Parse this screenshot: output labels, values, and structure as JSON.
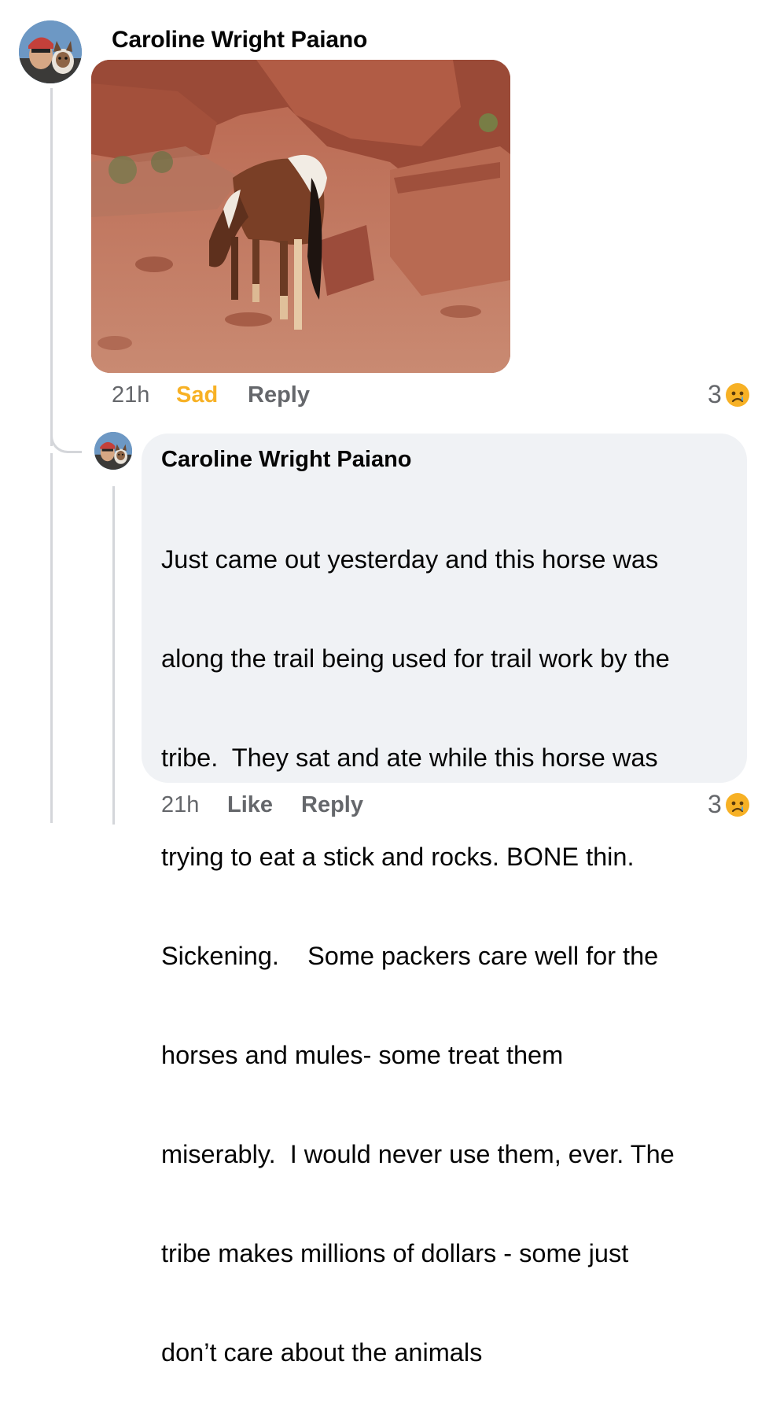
{
  "comment": {
    "author": "Caroline Wright Paiano",
    "time": "21h",
    "reaction_label": "Sad",
    "reply_label": "Reply",
    "reaction_count": "3",
    "reaction_icon": "sad-face-icon"
  },
  "reply": {
    "author": "Caroline Wright Paiano",
    "lines": [
      "Just came out yesterday and this horse was",
      "along the trail being used for trail work by the",
      "tribe.  They sat and ate while this horse was",
      "trying to eat a stick and rocks. BONE thin.",
      "Sickening.    Some packers care well for the",
      "horses and mules- some treat them",
      "miserably.  I would never use them, ever. The",
      "tribe makes millions of dollars - some just",
      "don’t care about the animals"
    ],
    "time": "21h",
    "like_label": "Like",
    "reply_label": "Reply",
    "reaction_count": "3",
    "reaction_icon": "sad-face-icon"
  },
  "colors": {
    "sad_accent": "#f7b125",
    "meta_gray": "#65676b",
    "bubble_bg": "#f0f2f5"
  }
}
